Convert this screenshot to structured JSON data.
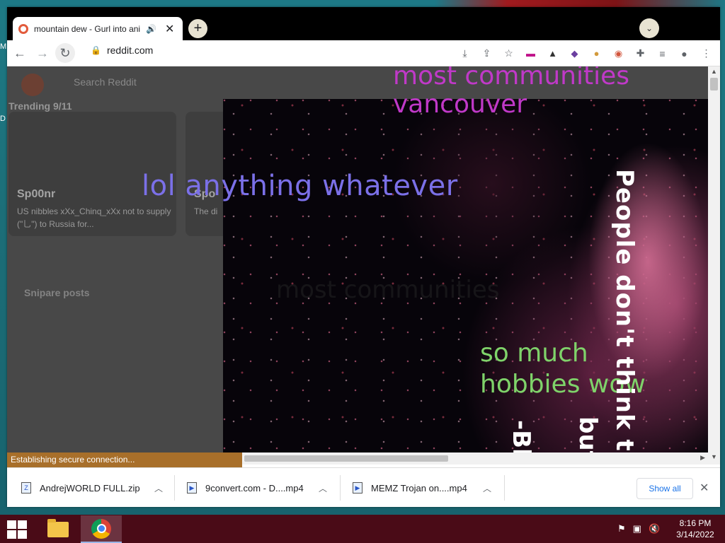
{
  "desktop": {
    "icon_letter_top": "M",
    "icon_letter_mid": "D"
  },
  "browser": {
    "tab": {
      "title": "mountain dew - Gurl into anime",
      "close": "✕",
      "audio": "🔊"
    },
    "new_tab": "+",
    "tab_search": "⌄",
    "address": "reddit.com",
    "status_text": "Establishing secure connection..."
  },
  "reddit_bg": {
    "search_placeholder": "Search Reddit",
    "trending": "Trending 9/11",
    "card1_title": "Sp00nr",
    "card1_sub": "US nibbles xXx_Chinq_xXx not to supply (\"乚\") to Russia for...",
    "card2_title": "Spo",
    "card2_sub": "The di",
    "side_label": "Snipare posts"
  },
  "overlay_text": {
    "communities": "most communities\nvancouver",
    "lol": "lol anything whatever",
    "faint": "most communities",
    "hobbies": "so much\nhobbies wow",
    "people": "People don't think th",
    "but": "but",
    "bl": "-Bl"
  },
  "downloads": [
    {
      "name": "AndrejWORLD FULL.zip",
      "icon": "Z"
    },
    {
      "name": "9convert.com - D....mp4",
      "icon": "▶"
    },
    {
      "name": "MEMZ Trojan on....mp4",
      "icon": "▶"
    }
  ],
  "downloads_show_all": "Show all",
  "downloads_close": "✕",
  "taskbar": {
    "time": "8:16 PM",
    "date": "3/14/2022"
  },
  "colors": {
    "taskbar": "#4a0b17",
    "status": "#a86f2a",
    "tabstrip": "#000000"
  }
}
